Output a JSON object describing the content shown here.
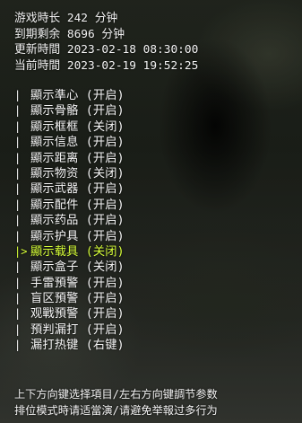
{
  "info": {
    "play_time": "游戏時长 242 分钟",
    "remaining": "到期剩余 8696 分钟",
    "updated": "更新時間 2023-02-18 08:30:00",
    "current": "当前時間 2023-02-19 19:52:25"
  },
  "menu": {
    "normal_marker": "|",
    "selected_marker": "|>",
    "items": [
      {
        "label": "顯示準心 (开启)"
      },
      {
        "label": "顯示骨骼 (开启)"
      },
      {
        "label": "顯示框框 (关闭)"
      },
      {
        "label": "顯示信息 (开启)"
      },
      {
        "label": "顯示距离 (开启)"
      },
      {
        "label": "顯示物资 (关闭)"
      },
      {
        "label": "顯示武器 (开启)"
      },
      {
        "label": "顯示配件 (开启)"
      },
      {
        "label": "顯示药品 (开启)"
      },
      {
        "label": "顯示护具 (开启)"
      },
      {
        "label": "顯示载具 (关闭)"
      },
      {
        "label": "顯示盒子 (关闭)"
      },
      {
        "label": "手雷預警 (开启)"
      },
      {
        "label": "盲区預警 (开启)"
      },
      {
        "label": "观戰預警 (开启)"
      },
      {
        "label": "預判漏打 (开启)"
      },
      {
        "label": "漏打热键 (右键)"
      }
    ],
    "selected_index": 10,
    "selected_color": "#d7ff38"
  },
  "footer": {
    "line1": "上下方向键选择項目/左右方向键調节参数",
    "line2": "排位模式時请适當演/请避免举報过多行为"
  }
}
